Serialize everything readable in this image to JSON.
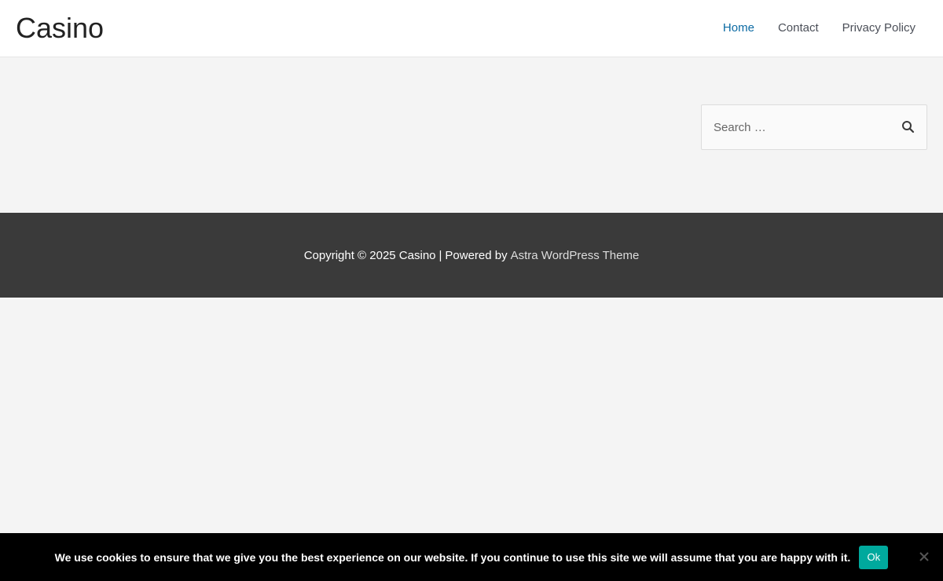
{
  "header": {
    "site_title": "Casino",
    "nav": [
      {
        "label": "Home",
        "current": true
      },
      {
        "label": "Contact",
        "current": false
      },
      {
        "label": "Privacy Policy",
        "current": false
      }
    ]
  },
  "search": {
    "placeholder": "Search …",
    "icon": "search-icon"
  },
  "footer": {
    "copyright": "Copyright © 2025 Casino",
    "separator": "|",
    "powered_by": "Powered by",
    "theme_link": "Astra WordPress Theme"
  },
  "cookie_notice": {
    "text": "We use cookies to ensure that we give you the best experience on our website. If you continue to use this site we will assume that you are happy with it.",
    "ok_label": "Ok",
    "close_icon": "close-icon"
  },
  "colors": {
    "accent": "#0b6aa3",
    "footer_bg": "#3a3a3a",
    "cookie_button": "#00a99d",
    "page_bg": "#f4f4f4"
  }
}
